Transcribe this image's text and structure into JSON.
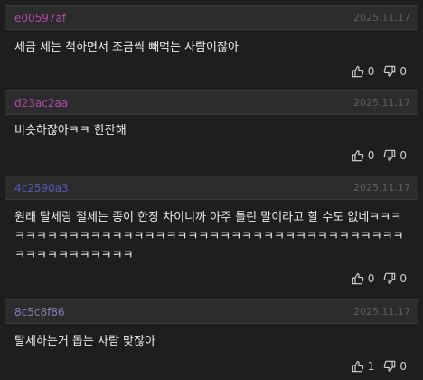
{
  "comments": [
    {
      "author": "e00597af",
      "author_color": "#b24aa9",
      "date": "2025.11.17",
      "text": "세금 세는 척하면서 조금씩 빼먹는 사람이잖아",
      "likes": "0",
      "dislikes": "0"
    },
    {
      "author": "d23ac2aa",
      "author_color": "#b24aa9",
      "date": "2025.11.17",
      "text": "비슷하잖아ㅋㅋ 한잔해",
      "likes": "0",
      "dislikes": "0"
    },
    {
      "author": "4c2590a3",
      "author_color": "#5a55b6",
      "date": "2025.11.17",
      "text": "원래 탈세랑 절세는 종이 한장 차이니까 아주 틀린 말이라고 할 수도 없네ㅋㅋㅋㅋㅋㅋㅋㅋㅋㅋㅋㅋㅋㅋㅋㅋㅋㅋㅋㅋㅋㅋㅋㅋㅋㅋㅋㅋㅋㅋㅋㅋㅋㅋㅋㅋㅋㅋㅋㅋㅋㅋㅋㅋㅋㅋㅋㅋㅋㅋ",
      "likes": "0",
      "dislikes": "0"
    },
    {
      "author": "8c5c8f86",
      "author_color": "#7e82b4",
      "date": "2025.11.17",
      "text": "탈세하는거 돕는 사람 맞잖아",
      "likes": "1",
      "dislikes": "0"
    }
  ]
}
